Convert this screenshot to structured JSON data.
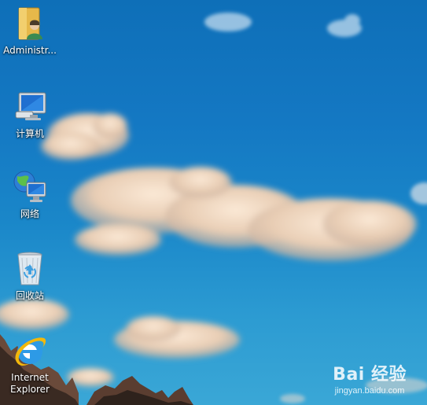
{
  "desktop": {
    "icons": [
      {
        "label": "Administr...",
        "icon": "user-folder-icon"
      },
      {
        "label": "计算机",
        "icon": "computer-icon"
      },
      {
        "label": "网络",
        "icon": "network-icon"
      },
      {
        "label": "回收站",
        "icon": "recycle-bin-icon"
      },
      {
        "label": "Internet\nExplorer",
        "icon": "internet-explorer-icon"
      }
    ]
  },
  "watermark": {
    "brand": "Bai 经验",
    "url": "jingyan.baidu.com"
  },
  "colors": {
    "sky_top": "#0e6fb8",
    "sky_bottom": "#3aa7d6",
    "label_text": "#ffffff"
  }
}
